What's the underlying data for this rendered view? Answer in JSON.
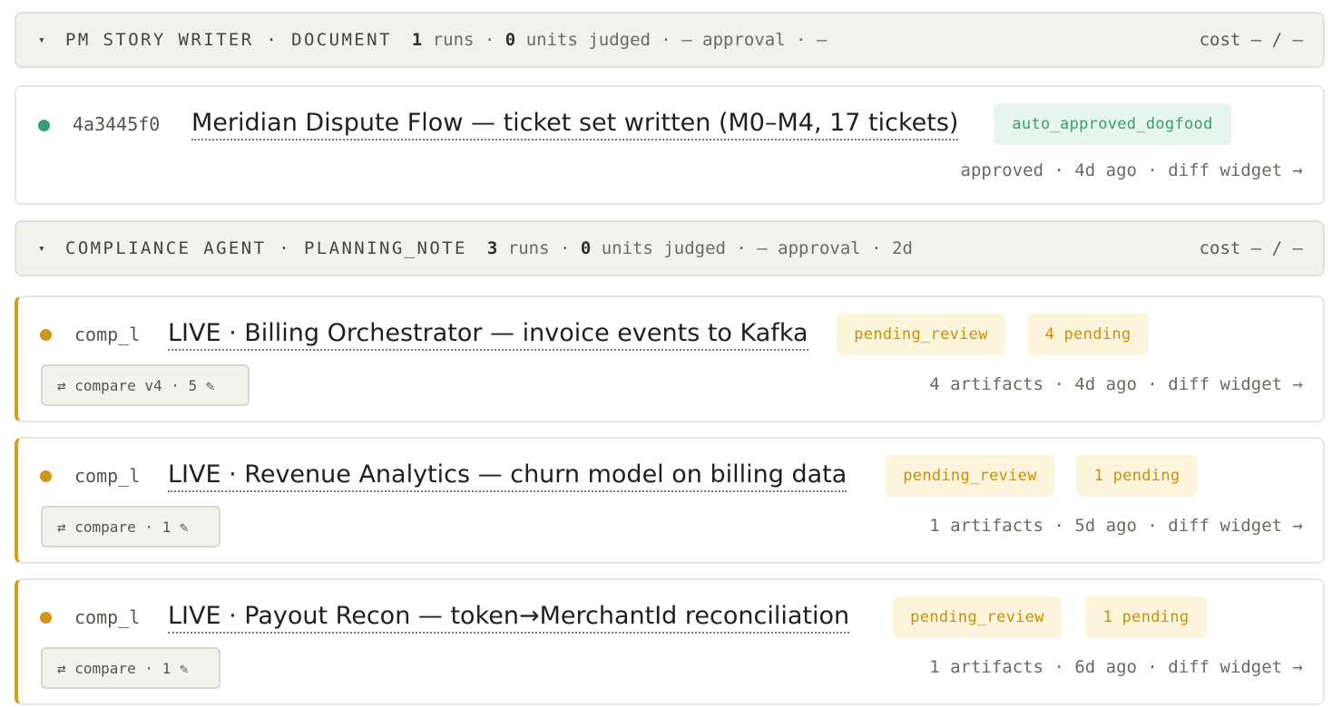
{
  "groups": [
    {
      "caret": "▾",
      "name": "PM STORY WRITER · DOCUMENT",
      "runs_count": "1",
      "runs_label": " runs · ",
      "units_count": "0",
      "units_label": " units judged · — approval · —",
      "cost": "cost — / —"
    },
    {
      "caret": "▾",
      "name": "COMPLIANCE AGENT · PLANNING_NOTE",
      "runs_count": "3",
      "runs_label": " runs · ",
      "units_count": "0",
      "units_label": " units judged · — approval · 2d",
      "cost": "cost — / —"
    }
  ],
  "runs": [
    {
      "id": "4a3445f0",
      "title": "Meridian Dispute Flow — ticket set written (M0–M4, 17 tickets)",
      "status": "auto_approved_dogfood",
      "meta": "approved · 4d ago · diff widget →",
      "status_color": "#3a9b78"
    },
    {
      "id": "comp_l",
      "title": "LIVE · Billing Orchestrator — invoice events to Kafka",
      "status": "pending_review",
      "pending": "4 pending",
      "compare": "⇄ compare v4 · 5 ✎",
      "meta": "4 artifacts · 4d ago · diff widget →",
      "status_color": "#d09519"
    },
    {
      "id": "comp_l",
      "title": "LIVE · Revenue Analytics — churn model on billing data",
      "status": "pending_review",
      "pending": "1 pending",
      "compare": "⇄ compare · 1 ✎",
      "meta": "1 artifacts · 5d ago · diff widget →",
      "status_color": "#d09519"
    },
    {
      "id": "comp_l",
      "title": "LIVE · Payout Recon — token→MerchantId reconciliation",
      "status": "pending_review",
      "pending": "1 pending",
      "compare": "⇄ compare · 1 ✎",
      "meta": "1 artifacts · 6d ago · diff widget →",
      "status_color": "#d09519"
    }
  ]
}
